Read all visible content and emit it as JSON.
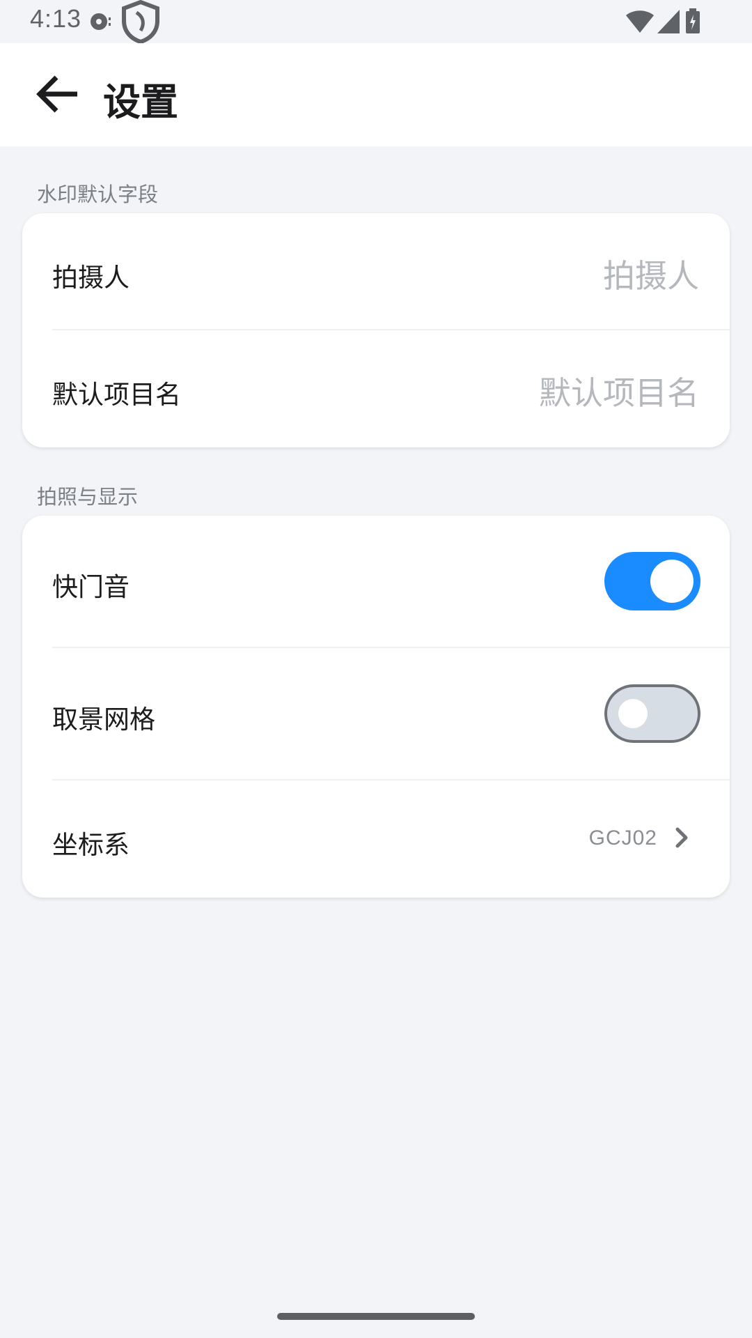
{
  "status_bar": {
    "time": "4:13",
    "icons": [
      "media-icon",
      "shield-icon",
      "wifi-icon",
      "signal-icon",
      "battery-icon"
    ]
  },
  "app_bar": {
    "title": "设置",
    "back_icon": "arrow-left-icon"
  },
  "sections": {
    "watermark": {
      "header": "水印默认字段",
      "photographer": {
        "label": "拍摄人",
        "placeholder": "拍摄人"
      },
      "project": {
        "label": "默认项目名",
        "placeholder": "默认项目名"
      }
    },
    "display": {
      "header": "拍照与显示",
      "shutter_sound": {
        "label": "快门音",
        "enabled": true
      },
      "grid": {
        "label": "取景网格",
        "enabled": false
      },
      "coordinate": {
        "label": "坐标系",
        "value": "GCJ02"
      }
    }
  },
  "colors": {
    "accent": "#1a8cff",
    "background": "#f2f4f7",
    "card": "#ffffff"
  }
}
